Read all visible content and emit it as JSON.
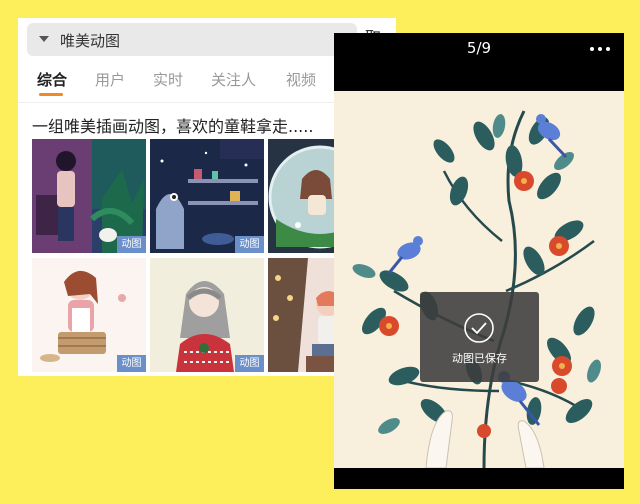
{
  "search": {
    "query": "唯美动图",
    "cancel_label": "取消"
  },
  "tabs": [
    {
      "label": "综合",
      "active": true
    },
    {
      "label": "用户",
      "active": false
    },
    {
      "label": "实时",
      "active": false
    },
    {
      "label": "关注人",
      "active": false
    },
    {
      "label": "视频",
      "active": false
    }
  ],
  "result": {
    "title": "一组唯美插画动图，喜欢的童鞋拿走.....",
    "badge_label": "动图"
  },
  "viewer": {
    "page_counter": "5/9",
    "toast_text": "动图已保存"
  },
  "colors": {
    "background": "#fdee5c",
    "tab_indicator": "#f08a24",
    "badge": "#6b8fc8"
  }
}
